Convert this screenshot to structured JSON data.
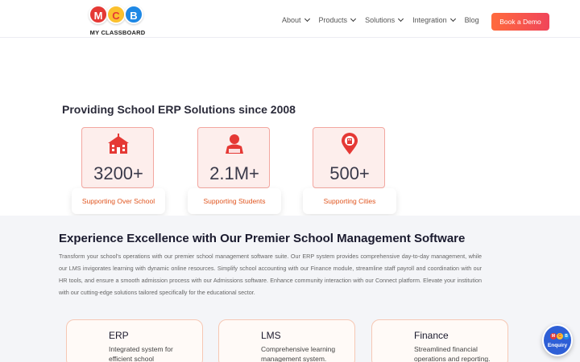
{
  "header": {
    "logo_text": "MY CLASSBOARD",
    "logo_letters": [
      "M",
      "C",
      "B"
    ],
    "nav": [
      {
        "label": "About",
        "has_dropdown": true
      },
      {
        "label": "Products",
        "has_dropdown": true
      },
      {
        "label": "Solutions",
        "has_dropdown": true
      },
      {
        "label": "Integration",
        "has_dropdown": true
      },
      {
        "label": "Blog",
        "has_dropdown": false
      }
    ],
    "cta_label": "Book a Demo"
  },
  "stats": {
    "title": "Providing School ERP Solutions since 2008",
    "items": [
      {
        "icon": "school-building-icon",
        "value": "3200+",
        "label": "Supporting Over School"
      },
      {
        "icon": "student-icon",
        "value": "2.1M+",
        "label": "Supporting Students"
      },
      {
        "icon": "city-location-icon",
        "value": "500+",
        "label": "Supporting Cities"
      }
    ]
  },
  "software": {
    "title": "Experience Excellence with Our Premier School Management Software",
    "description": "Transform your school's operations with our premier school management software suite. Our ERP system provides comprehensive day-to-day management, while our LMS invigorates learning with dynamic online resources. Simplify school accounting with our Finance module, streamline staff payroll and coordination with our HR tools, and ensure a smooth admission process with our Admissions software. Enhance community interaction with our Connect platform. Elevate your institution with our cutting-edge solutions tailored specifically for the educational sector.",
    "modules": [
      {
        "name": "ERP",
        "desc": "Integrated system for efficient school"
      },
      {
        "name": "LMS",
        "desc": "Comprehensive learning management system."
      },
      {
        "name": "Finance",
        "desc": "Streamlined financial operations and reporting."
      }
    ]
  },
  "enquiry": {
    "label": "Enquiry",
    "letters": [
      "M",
      "C",
      "B"
    ]
  },
  "colors": {
    "accent": "#f0455a",
    "stat_text": "#e0551f",
    "logo_m": "#e53935",
    "logo_c": "#fbc02d",
    "logo_b": "#1e88e5"
  }
}
